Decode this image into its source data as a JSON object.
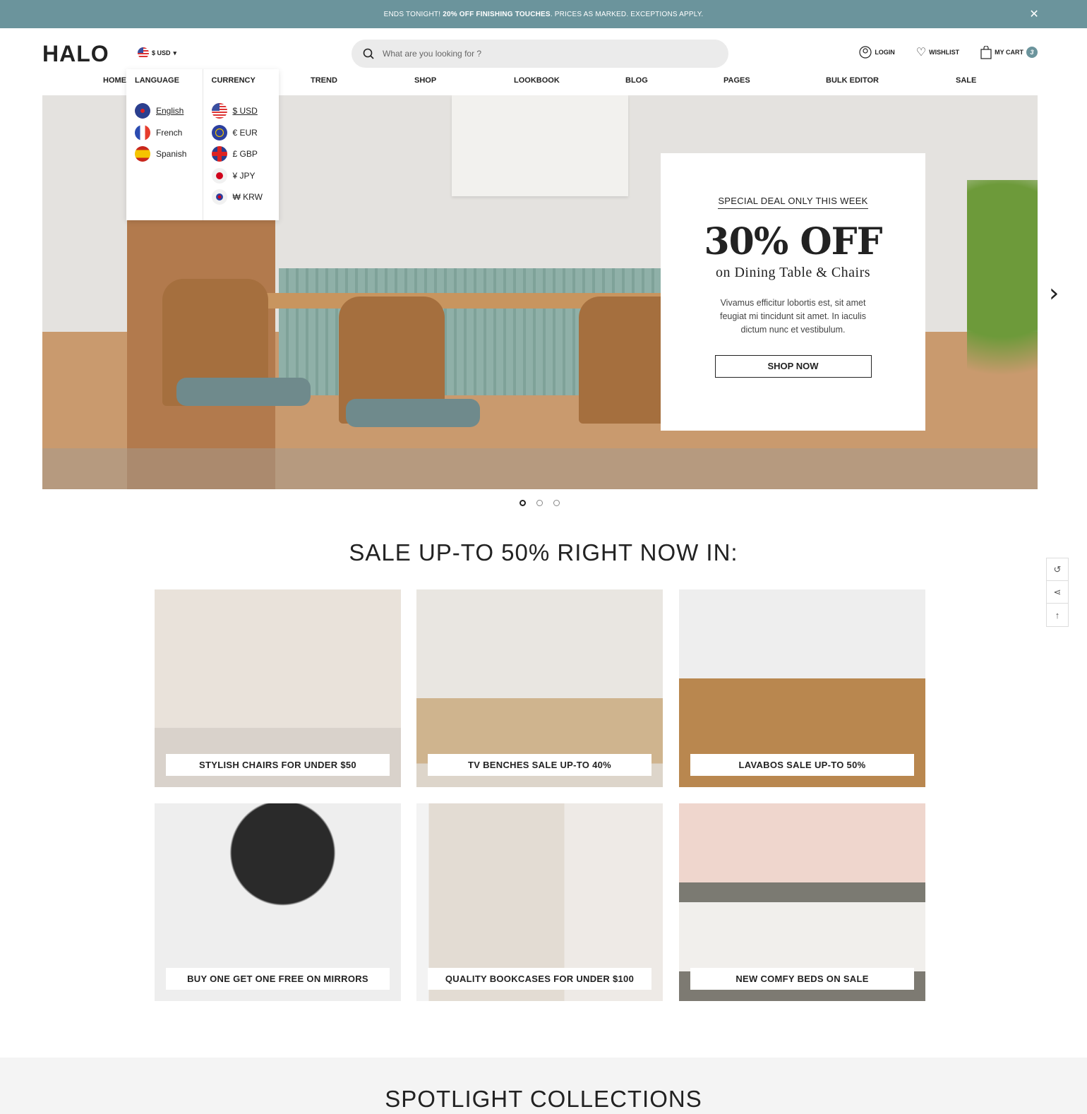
{
  "announcement": {
    "prefix": "ENDS TONIGHT!",
    "bold": "20% OFF FINISHING TOUCHES",
    "suffix": ". PRICES AS MARKED. EXCEPTIONS APPLY.",
    "close": "✕"
  },
  "header": {
    "logo": "HALO",
    "currency": "$ USD",
    "search_placeholder": "What are you looking for ?",
    "login": "LOGIN",
    "wishlist": "WISHLIST",
    "cart": "MY CART",
    "cart_count": "3"
  },
  "nav": [
    "HOME",
    "TREND",
    "SHOP",
    "LOOKBOOK",
    "BLOG",
    "PAGES",
    "BULK EDITOR",
    "SALE"
  ],
  "dropdown": {
    "language_title": "LANGUAGE",
    "currency_title": "CURRENCY",
    "languages": [
      "English",
      "French",
      "Spanish"
    ],
    "currencies": [
      "$ USD",
      "€ EUR",
      "£ GBP",
      "¥ JPY",
      "₩ KRW"
    ]
  },
  "hero": {
    "subtitle": "SPECIAL DEAL ONLY THIS WEEK",
    "title": "30% OFF",
    "caption": "on Dining Table & Chairs",
    "text": "Vivamus efficitur lobortis est, sit amet feugiat mi tincidunt sit amet.  In iaculis dictum nunc et vestibulum.",
    "button": "SHOP NOW",
    "slides": 3,
    "active_slide": 1
  },
  "sale": {
    "heading": "SALE UP-TO 50% RIGHT NOW IN:",
    "cards": [
      "STYLISH CHAIRS FOR UNDER $50",
      "TV BENCHES SALE UP-TO 40%",
      "LAVABOS SALE UP-TO 50%",
      "BUY ONE GET ONE FREE ON MIRRORS",
      "QUALITY BOOKCASES FOR UNDER $100",
      "NEW COMFY BEDS ON SALE"
    ]
  },
  "spotlight": {
    "heading": "SPOTLIGHT COLLECTIONS"
  },
  "colors": {
    "accent": "#6b949c"
  }
}
